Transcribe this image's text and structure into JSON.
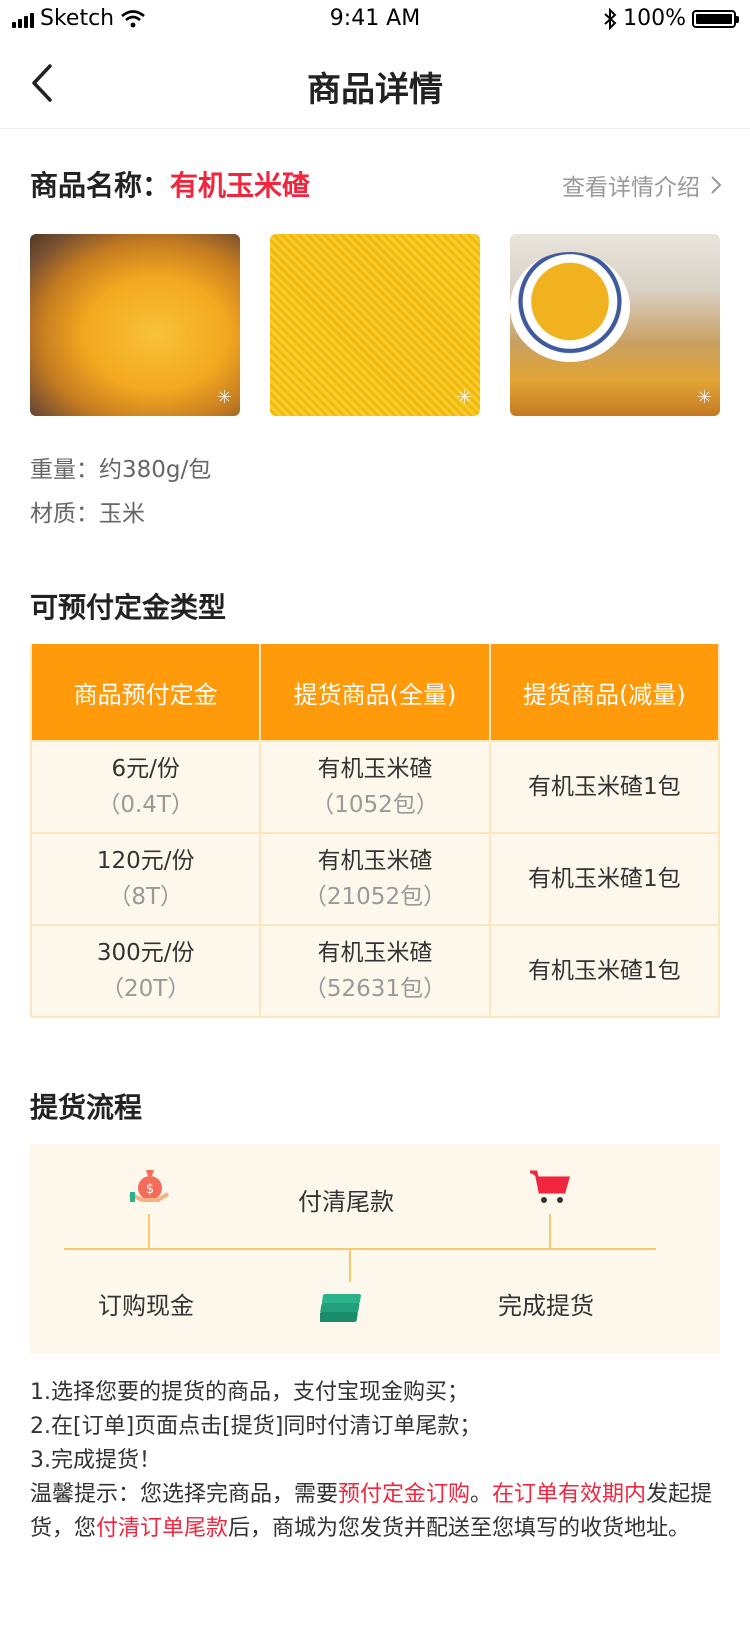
{
  "status_bar": {
    "carrier": "Sketch",
    "time": "9:41 AM",
    "battery": "100%"
  },
  "nav": {
    "title": "商品详情"
  },
  "product": {
    "name_label": "商品名称：",
    "name_value": "有机玉米碴",
    "detail_link": "查看详情介绍",
    "images": [
      "corn-grits-bowl",
      "corn-grits-closeup",
      "corn-meal-bowl"
    ],
    "weight": "重量：约380g/包",
    "material": "材质：玉米"
  },
  "deposit": {
    "title": "可预付定金类型",
    "headers": [
      "商品预付定金",
      "提货商品(全量)",
      "提货商品(减量)"
    ],
    "rows": [
      {
        "price": "6元/份",
        "price_sub": "（0.4T）",
        "full": "有机玉米碴",
        "full_sub": "（1052包）",
        "reduced": "有机玉米碴1包"
      },
      {
        "price": "120元/份",
        "price_sub": "（8T）",
        "full": "有机玉米碴",
        "full_sub": "（21052包）",
        "reduced": "有机玉米碴1包"
      },
      {
        "price": "300元/份",
        "price_sub": "（20T）",
        "full": "有机玉米碴",
        "full_sub": "（52631包）",
        "reduced": "有机玉米碴1包"
      }
    ]
  },
  "process": {
    "title": "提货流程",
    "steps": {
      "order": "订购现金",
      "pay": "付清尾款",
      "done": "完成提货"
    }
  },
  "notes": {
    "line1": "1.选择您要的提货的商品，支付宝现金购买；",
    "line2": "2.在[订单]页面点击[提货]同时付清订单尾款；",
    "line3": "3.完成提货！",
    "tip_a": "温馨提示：您选择完商品，需要",
    "tip_b": "预付定金订购",
    "tip_c": "。",
    "tip_d": "在订单有效期内",
    "tip_e": "发起提货，您",
    "tip_f": "付清订单尾款",
    "tip_g": "后，商城为您发货并配送至您填写的收货地址。"
  },
  "colors": {
    "accent": "#ff9a0a",
    "red": "#f0263f",
    "table_bg": "#fef8ec",
    "line": "#f8c86f"
  }
}
